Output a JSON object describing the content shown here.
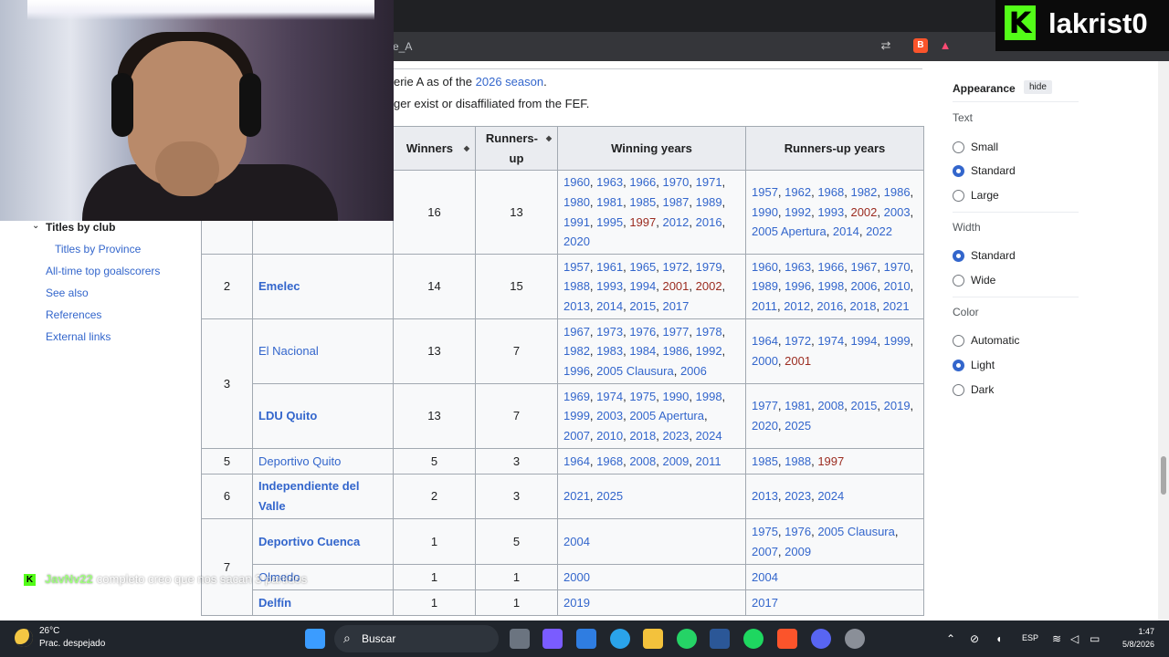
{
  "browser": {
    "url_fragment": "e_A"
  },
  "stream": {
    "channel": "lakrist0"
  },
  "chat": {
    "user": "JavNv22",
    "message": "completo creo que nos sacan 3 partidos"
  },
  "toc": {
    "current": "Titles by club",
    "items": [
      "Titles by Province",
      "All-time top goalscorers",
      "See also",
      "References",
      "External links"
    ]
  },
  "article": {
    "line1_prefix": "erie A as of the ",
    "line1_link": "2026 season",
    "line1_suffix": ".",
    "line2": "ger exist or disaffiliated from the FEF."
  },
  "table": {
    "headers": [
      "Winners",
      "Runners-up",
      "Winning years",
      "Runners-up years"
    ],
    "rows": [
      {
        "rank": "",
        "club": "",
        "winners": "16",
        "runners": "13"
      },
      {
        "rank": "2",
        "club": "Emelec",
        "winners": "14",
        "runners": "15"
      },
      {
        "rank": "3",
        "club": "El Nacional",
        "winners": "13",
        "runners": "7"
      },
      {
        "rank": "",
        "club": "LDU Quito",
        "winners": "13",
        "runners": "7"
      },
      {
        "rank": "5",
        "club": "Deportivo Quito",
        "winners": "5",
        "runners": "3"
      },
      {
        "rank": "6",
        "club": "Independiente del Valle",
        "winners": "2",
        "runners": "3"
      },
      {
        "rank": "7",
        "club": "Deportivo Cuenca",
        "winners": "1",
        "runners": "5"
      },
      {
        "rank": "",
        "club": "Olmedo",
        "winners": "1",
        "runners": "1"
      },
      {
        "rank": "",
        "club": "Delfín",
        "winners": "1",
        "runners": "1"
      }
    ],
    "win_years": [
      [
        [
          "1960",
          0
        ],
        [
          "1963",
          0
        ],
        [
          "1966",
          0
        ],
        [
          "1970",
          0
        ],
        [
          "1971",
          0
        ],
        [
          "1980",
          0
        ],
        [
          "1981",
          0
        ],
        [
          "1985",
          0
        ],
        [
          "1987",
          0
        ],
        [
          "1989",
          0
        ],
        [
          "1991",
          0
        ],
        [
          "1995",
          0
        ],
        [
          "1997",
          1
        ],
        [
          "2012",
          0
        ],
        [
          "2016",
          0
        ],
        [
          "2020",
          0
        ]
      ],
      [
        [
          "1957",
          0
        ],
        [
          "1961",
          0
        ],
        [
          "1965",
          0
        ],
        [
          "1972",
          0
        ],
        [
          "1979",
          0
        ],
        [
          "1988",
          0
        ],
        [
          "1993",
          0
        ],
        [
          "1994",
          0
        ],
        [
          "2001",
          1
        ],
        [
          "2002",
          1
        ],
        [
          "2013",
          0
        ],
        [
          "2014",
          0
        ],
        [
          "2015",
          0
        ],
        [
          "2017",
          0
        ]
      ],
      [
        [
          "1967",
          0
        ],
        [
          "1973",
          0
        ],
        [
          "1976",
          0
        ],
        [
          "1977",
          0
        ],
        [
          "1978",
          0
        ],
        [
          "1982",
          0
        ],
        [
          "1983",
          0
        ],
        [
          "1984",
          0
        ],
        [
          "1986",
          0
        ],
        [
          "1992",
          0
        ],
        [
          "1996",
          0
        ],
        [
          "2005 Clausura",
          0
        ],
        [
          "2006",
          0
        ]
      ],
      [
        [
          "1969",
          0
        ],
        [
          "1974",
          0
        ],
        [
          "1975",
          0
        ],
        [
          "1990",
          0
        ],
        [
          "1998",
          0
        ],
        [
          "1999",
          0
        ],
        [
          "2003",
          0
        ],
        [
          "2005 Apertura",
          0
        ],
        [
          "2007",
          0
        ],
        [
          "2010",
          0
        ],
        [
          "2018",
          0
        ],
        [
          "2023",
          0
        ],
        [
          "2024",
          0
        ]
      ],
      [
        [
          "1964",
          0
        ],
        [
          "1968",
          0
        ],
        [
          "2008",
          0
        ],
        [
          "2009",
          0
        ],
        [
          "2011",
          0
        ]
      ],
      [
        [
          "2021",
          0
        ],
        [
          "2025",
          0
        ]
      ],
      [
        [
          "2004",
          0
        ]
      ],
      [
        [
          "2000",
          0
        ]
      ],
      [
        [
          "2019",
          0
        ]
      ]
    ],
    "run_years": [
      [
        [
          "1957",
          0
        ],
        [
          "1962",
          0
        ],
        [
          "1968",
          0
        ],
        [
          "1982",
          0
        ],
        [
          "1986",
          0
        ],
        [
          "1990",
          0
        ],
        [
          "1992",
          0
        ],
        [
          "1993",
          0
        ],
        [
          "2002",
          1
        ],
        [
          "2003",
          0
        ],
        [
          "2005 Apertura",
          0
        ],
        [
          "2014",
          0
        ],
        [
          "2022",
          0
        ]
      ],
      [
        [
          "1960",
          0
        ],
        [
          "1963",
          0
        ],
        [
          "1966",
          0
        ],
        [
          "1967",
          0
        ],
        [
          "1970",
          0
        ],
        [
          "1989",
          0
        ],
        [
          "1996",
          0
        ],
        [
          "1998",
          0
        ],
        [
          "2006",
          0
        ],
        [
          "2010",
          0
        ],
        [
          "2011",
          0
        ],
        [
          "2012",
          0
        ],
        [
          "2016",
          0
        ],
        [
          "2018",
          0
        ],
        [
          "2021",
          0
        ]
      ],
      [
        [
          "1964",
          0
        ],
        [
          "1972",
          0
        ],
        [
          "1974",
          0
        ],
        [
          "1994",
          0
        ],
        [
          "1999",
          0
        ],
        [
          "2000",
          0
        ],
        [
          "2001",
          1
        ]
      ],
      [
        [
          "1977",
          0
        ],
        [
          "1981",
          0
        ],
        [
          "2008",
          0
        ],
        [
          "2015",
          0
        ],
        [
          "2019",
          0
        ],
        [
          "2020",
          0
        ],
        [
          "2025",
          0
        ]
      ],
      [
        [
          "1985",
          0
        ],
        [
          "1988",
          0
        ],
        [
          "1997",
          1
        ]
      ],
      [
        [
          "2013",
          0
        ],
        [
          "2023",
          0
        ],
        [
          "2024",
          0
        ]
      ],
      [
        [
          "1975",
          0
        ],
        [
          "1976",
          0
        ],
        [
          "2005 Clausura",
          0
        ],
        [
          "2007",
          0
        ],
        [
          "2009",
          0
        ]
      ],
      [
        [
          "2004",
          0
        ]
      ],
      [
        [
          "2017",
          0
        ]
      ]
    ]
  },
  "appearance": {
    "title": "Appearance",
    "hide": "hide",
    "text_label": "Text",
    "text_options": [
      "Small",
      "Standard",
      "Large"
    ],
    "width_label": "Width",
    "width_options": [
      "Standard",
      "Wide"
    ],
    "color_label": "Color",
    "color_options": [
      "Automatic",
      "Light",
      "Dark"
    ]
  },
  "taskbar": {
    "temp": "26°C",
    "condition": "Prac. despejado",
    "search": "Buscar",
    "lang": "ESP",
    "time": "1:47",
    "date": "5/8/2026"
  },
  "colors": {
    "link": "#3366cc",
    "visited_red": "#d73333",
    "kick_green": "#53fc18"
  }
}
